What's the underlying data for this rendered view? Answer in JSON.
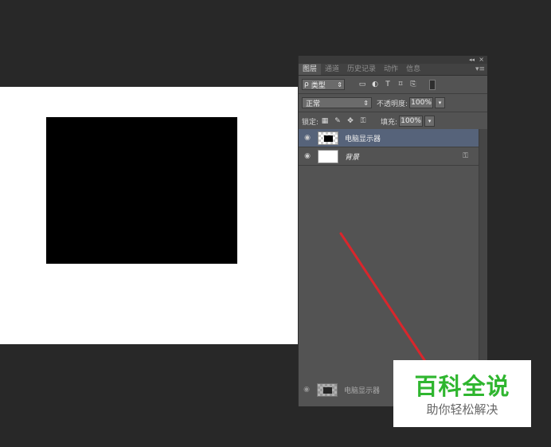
{
  "panel": {
    "collapse_glyph": "◂◂",
    "close_glyph": "×",
    "tabs": [
      {
        "label": "图层",
        "active": true
      },
      {
        "label": "通道",
        "active": false
      },
      {
        "label": "历史记录",
        "active": false
      },
      {
        "label": "动作",
        "active": false
      },
      {
        "label": "信息",
        "active": false
      }
    ],
    "menu_glyph": "▾≡",
    "filter": {
      "search_glyph": "ρ",
      "label": "类型",
      "spinner": "⇕"
    },
    "filter_icons": [
      "image-filter-icon",
      "adjustment-filter-icon",
      "type-filter-icon",
      "shape-filter-icon",
      "smart-object-filter-icon"
    ],
    "blend_mode": "正常",
    "opacity_label": "不透明度:",
    "opacity_value": "100%",
    "lock_label": "锁定:",
    "fill_label": "填充:",
    "fill_value": "100%",
    "layers": [
      {
        "name": "电脑显示器",
        "selected": true,
        "italic": false,
        "thumb": "checker"
      },
      {
        "name": "背景",
        "selected": false,
        "italic": true,
        "thumb": "white",
        "locked": true
      }
    ],
    "drag_ghost_name": "电脑显示器"
  },
  "watermark": {
    "title": "百科全说",
    "subtitle": "助你轻松解决"
  },
  "colors": {
    "workspace": "#282828",
    "panel": "#535353",
    "selected_layer": "#56637a",
    "arrow": "#d9262c",
    "watermark_green": "#2fb62f"
  }
}
